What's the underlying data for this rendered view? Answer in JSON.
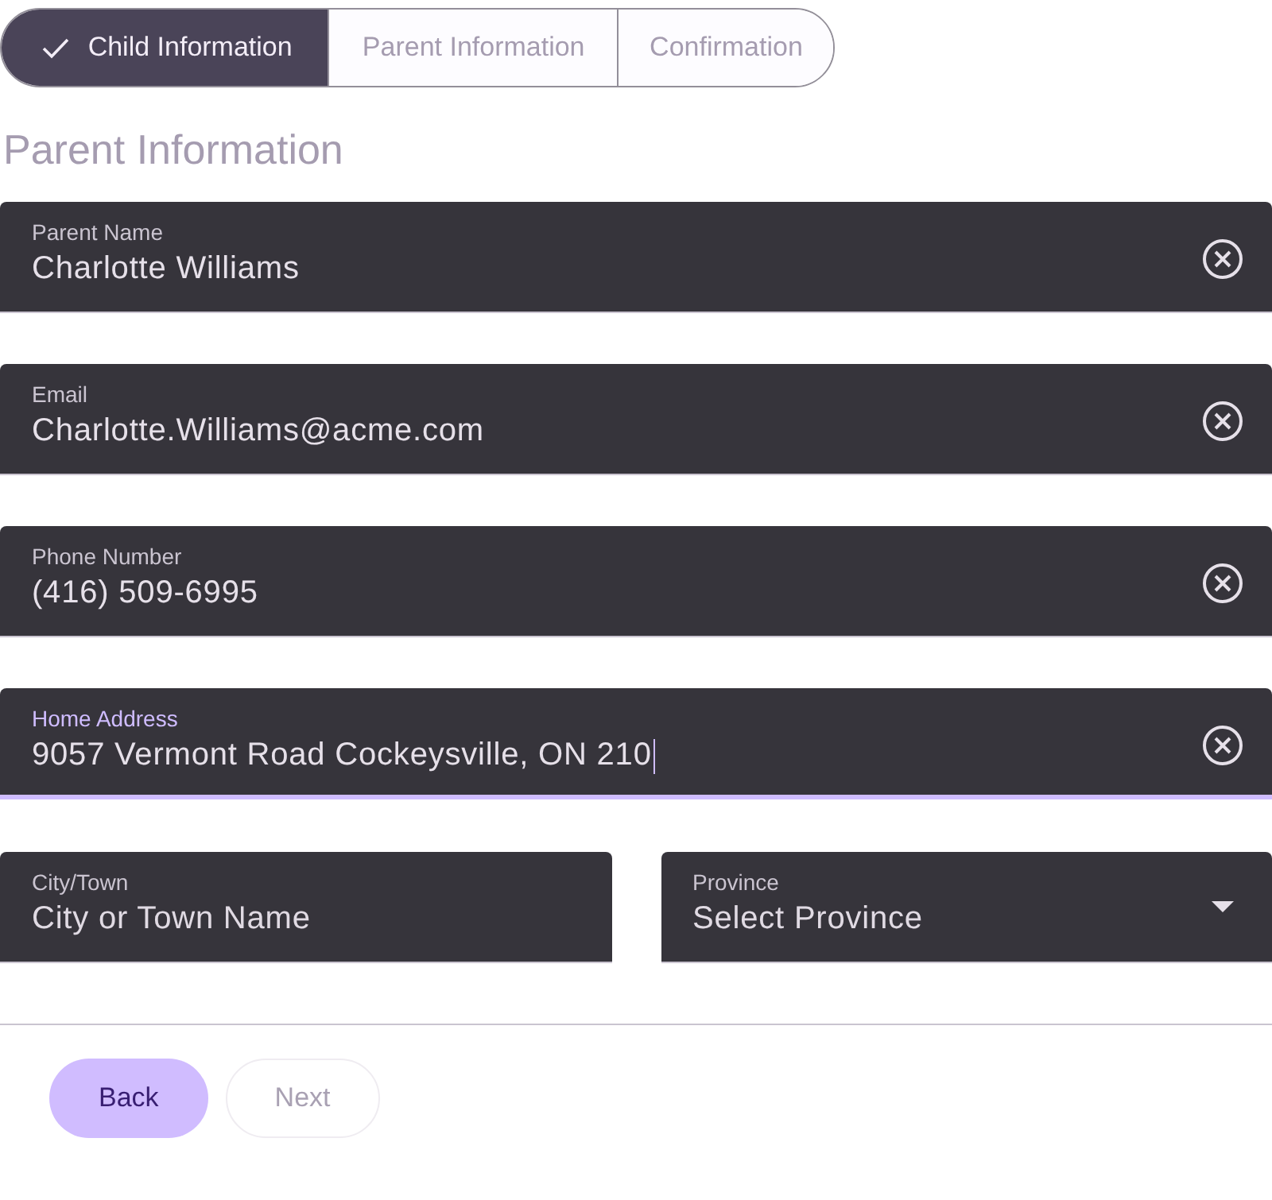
{
  "steps": [
    {
      "label": "Child Information",
      "selected": true,
      "done": true
    },
    {
      "label": "Parent Information",
      "selected": false,
      "done": false
    },
    {
      "label": "Confirmation",
      "selected": false,
      "done": false
    }
  ],
  "heading": "Parent Information",
  "fields": [
    {
      "kind": "text",
      "label": "Parent Name",
      "value": "Charlotte Williams",
      "focused": false
    },
    {
      "kind": "text",
      "label": "Email",
      "value": "Charlotte.Williams@acme.com",
      "focused": false
    },
    {
      "kind": "text",
      "label": "Phone Number",
      "value": "(416) 509-6995",
      "focused": false
    },
    {
      "kind": "text",
      "label": "Home Address",
      "value": "9057 Vermont Road Cockeysville, ON 210",
      "focused": true
    }
  ],
  "row_fields": [
    {
      "kind": "text",
      "label": "City/Town",
      "placeholder": "City or Town Name"
    },
    {
      "kind": "select",
      "label": "Province",
      "placeholder": "Select Province"
    }
  ],
  "buttons": [
    {
      "label": "Back",
      "disabled": false
    },
    {
      "label": "Next",
      "disabled": true
    }
  ]
}
